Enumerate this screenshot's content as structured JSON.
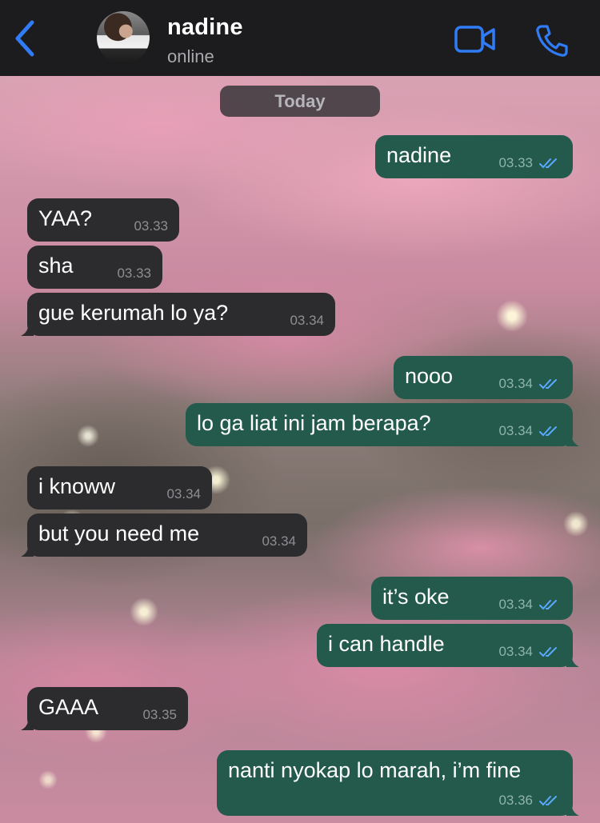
{
  "header": {
    "back_label": "Back",
    "contact_name": "nadine",
    "status": "online"
  },
  "chat": {
    "date_label": "Today",
    "messages": [
      {
        "dir": "out",
        "text": "nadine",
        "time": "03.33",
        "read": true
      },
      {
        "dir": "in",
        "text": "YAA?",
        "time": "03.33"
      },
      {
        "dir": "in",
        "text": "sha",
        "time": "03.33"
      },
      {
        "dir": "in",
        "text": "gue kerumah lo ya?",
        "time": "03.34"
      },
      {
        "dir": "out",
        "text": "nooo",
        "time": "03.34",
        "read": true
      },
      {
        "dir": "out",
        "text": "lo ga liat ini jam berapa?",
        "time": "03.34",
        "read": true
      },
      {
        "dir": "in",
        "text": "i knoww",
        "time": "03.34"
      },
      {
        "dir": "in",
        "text": "but you need me",
        "time": "03.34"
      },
      {
        "dir": "out",
        "text": "it’s oke",
        "time": "03.34",
        "read": true
      },
      {
        "dir": "out",
        "text": "i can handle",
        "time": "03.34",
        "read": true
      },
      {
        "dir": "in",
        "text": "GAAA",
        "time": "03.35"
      },
      {
        "dir": "out",
        "text": "nanti nyokap lo marah, i’m fine",
        "time": "03.36",
        "read": true
      }
    ]
  },
  "icons": {
    "back": "chevron-left-icon",
    "video": "video-camera-icon",
    "call": "phone-icon",
    "read_receipt": "double-check-icon"
  },
  "colors": {
    "accent": "#2f7cf6",
    "incoming_bubble": "#2c2c2e",
    "outgoing_bubble": "#235a4b",
    "header_bg": "#1c1c1e"
  }
}
